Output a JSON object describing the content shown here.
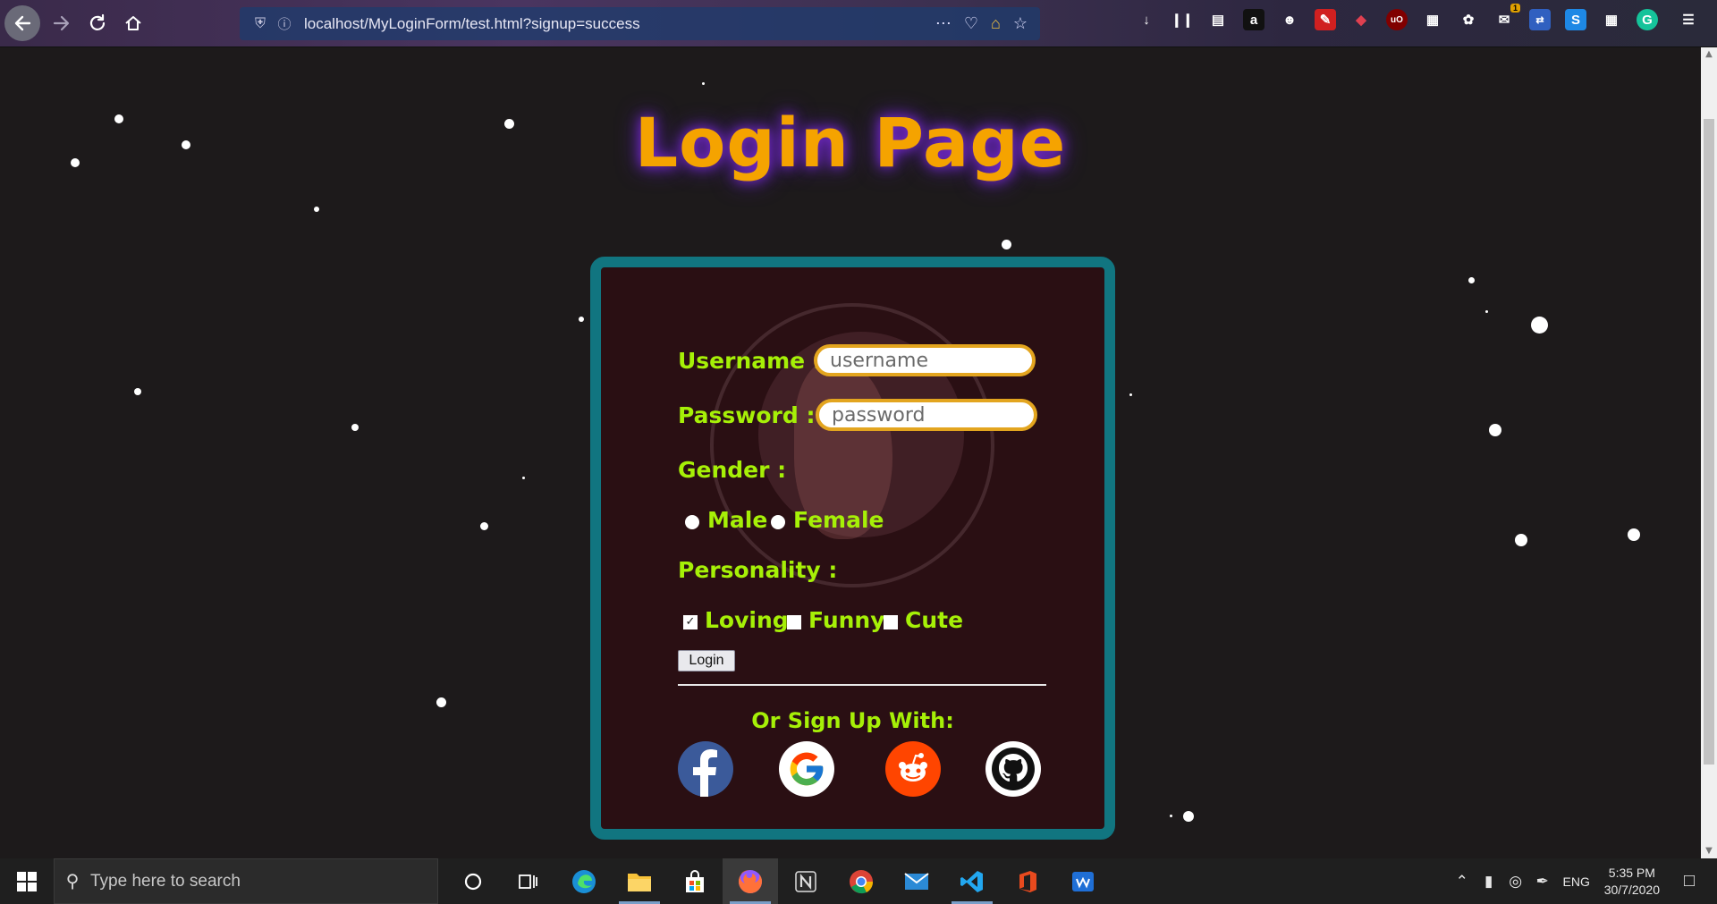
{
  "browser": {
    "url": "localhost/MyLoginForm/test.html?signup=success",
    "notification_badge": "1"
  },
  "page": {
    "title": "Login Page"
  },
  "form": {
    "username_label": "Username :",
    "username_placeholder": "username",
    "password_label": "Password :",
    "password_placeholder": "password",
    "gender_label": "Gender :",
    "gender_options": [
      "Male",
      "Female"
    ],
    "personality_label": "Personality :",
    "personality_options": [
      "Loving",
      "Funny",
      "Cute"
    ],
    "personality_checked": "Loving",
    "login_label": "Login",
    "or_sign_up": "Or Sign Up With:",
    "social_providers": [
      "facebook-icon",
      "google-icon",
      "reddit-icon",
      "github-icon"
    ]
  },
  "taskbar": {
    "search_placeholder": "Type here to search",
    "language": "ENG",
    "time": "5:35 PM",
    "date": "30/7/2020"
  },
  "colors": {
    "title": "#f5a300",
    "title_glow": "#7a2bd6",
    "label": "#a6f007",
    "card_border": "#117580",
    "card_bg": "#2a0f13",
    "input_border": "#e3a51f"
  }
}
